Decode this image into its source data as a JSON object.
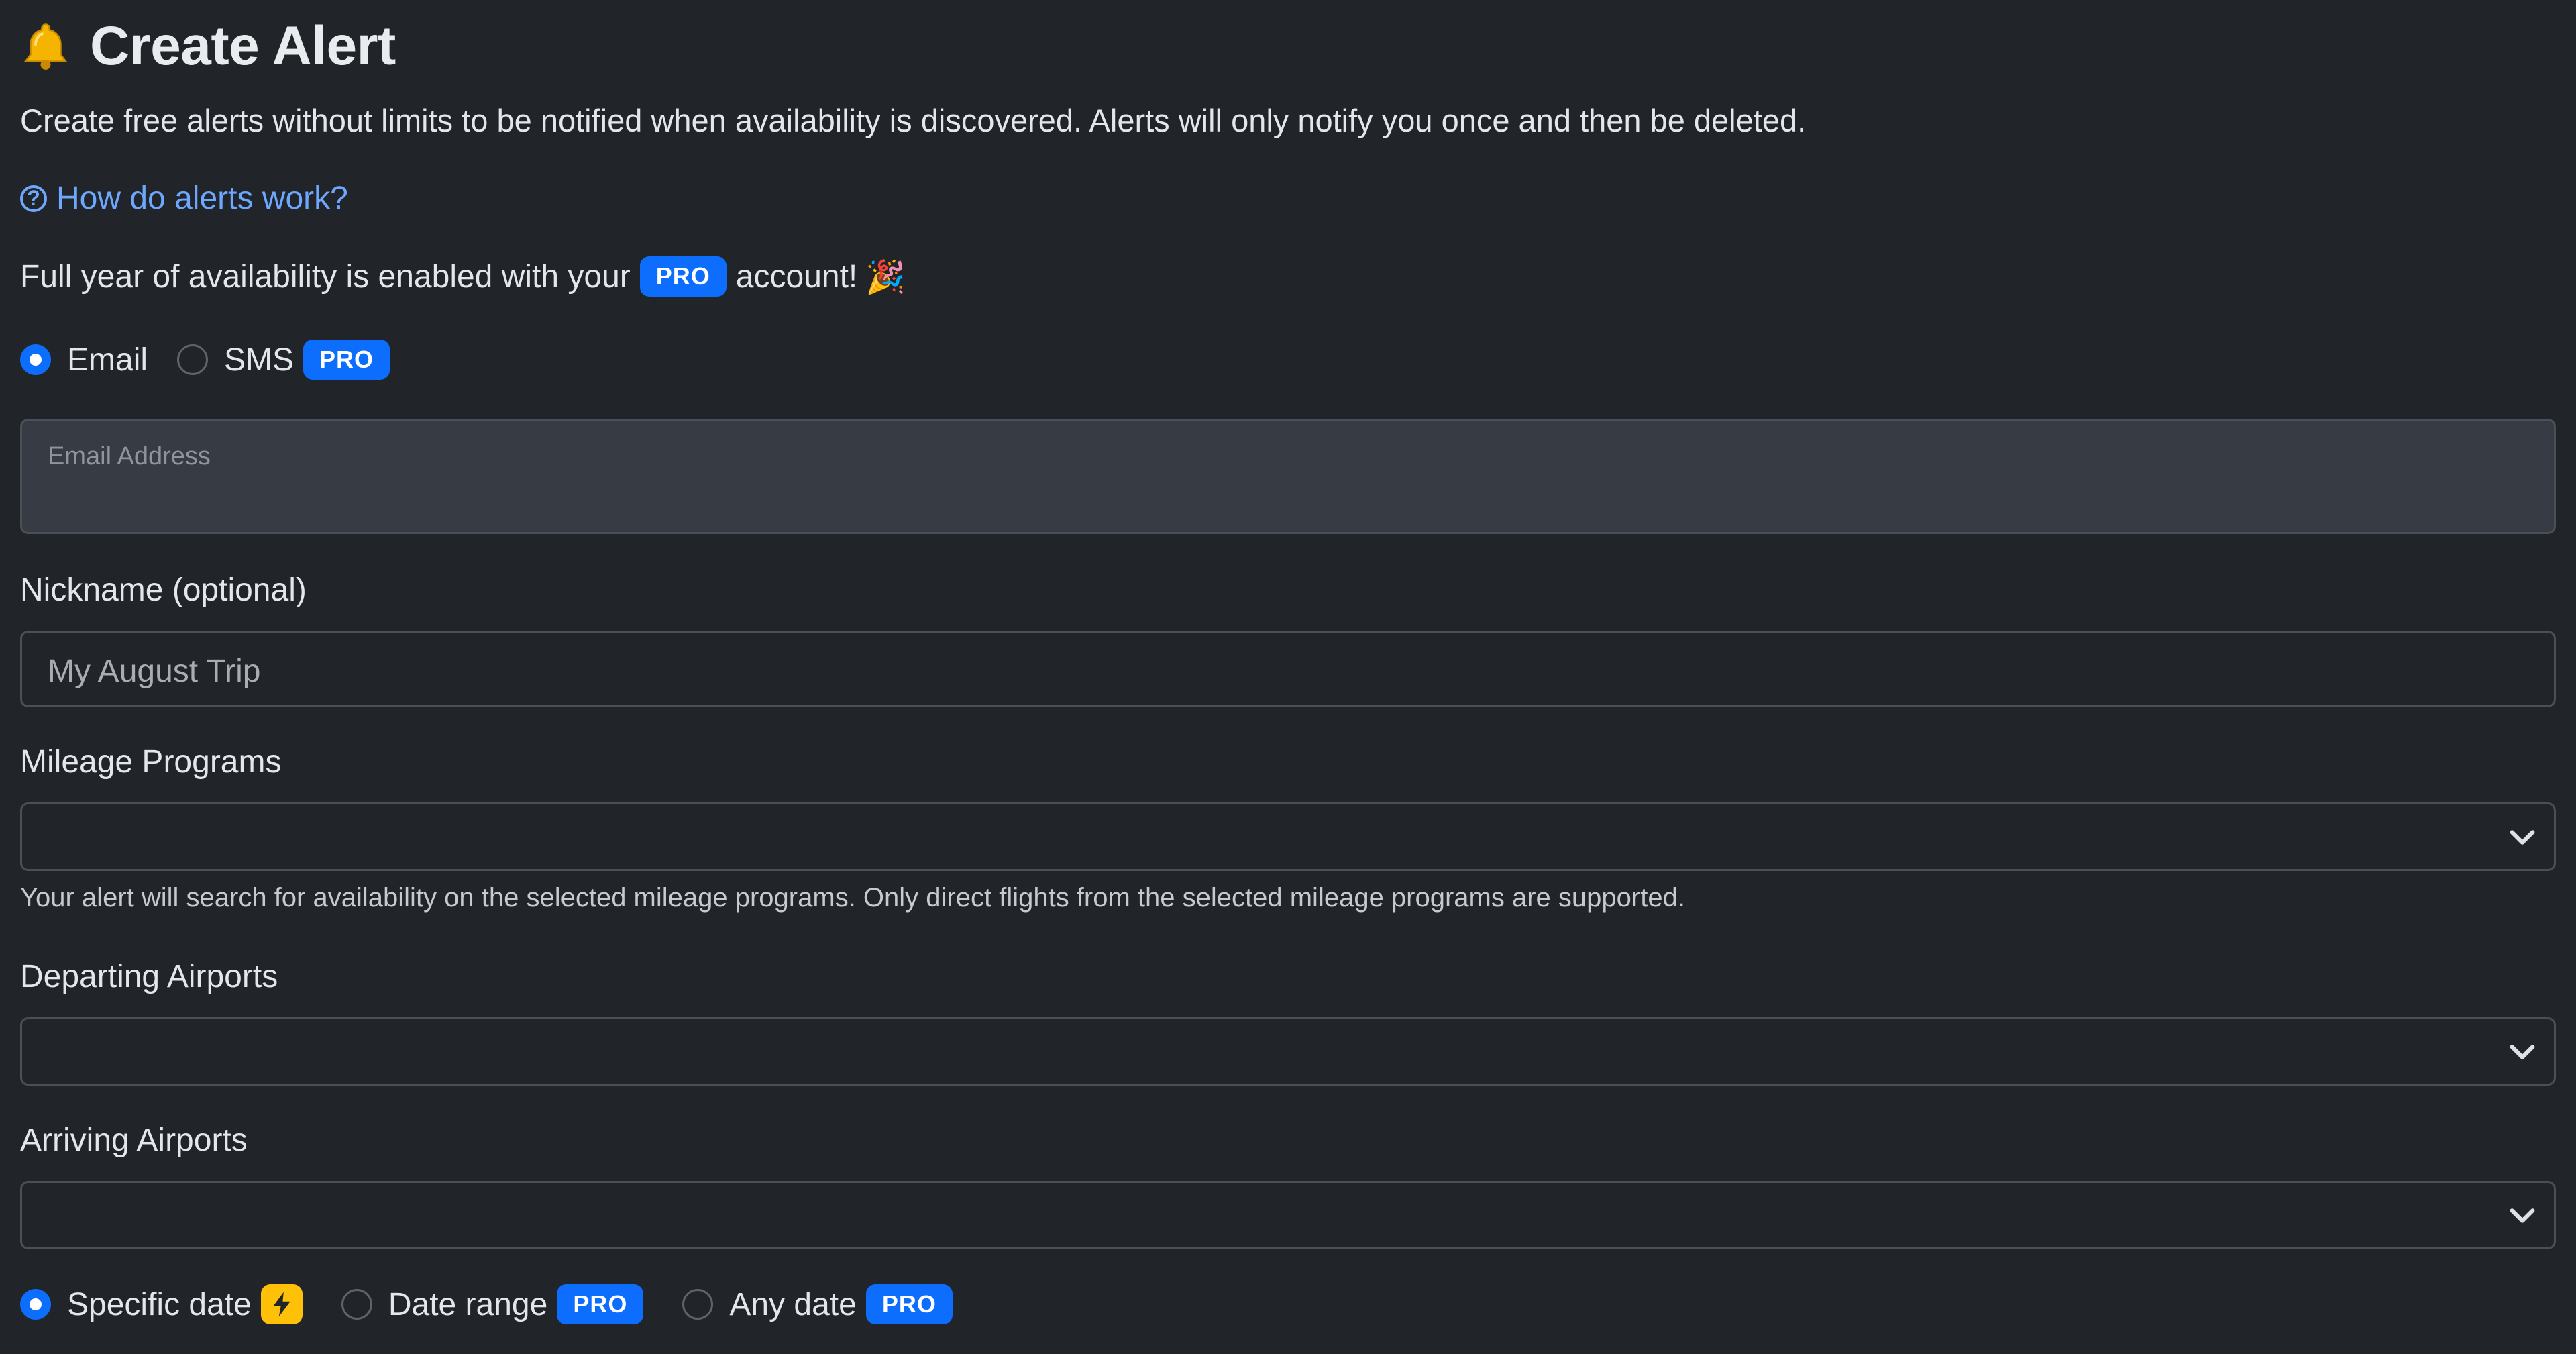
{
  "header": {
    "icon": "bell-icon",
    "title": "Create Alert"
  },
  "description": "Create free alerts without limits to be notified when availability is discovered. Alerts will only notify you once and then be deleted.",
  "help_link": {
    "icon": "question-circle-icon",
    "label": "How do alerts work?"
  },
  "pro_notice": {
    "before": "Full year of availability is enabled with your",
    "badge": "PRO",
    "after": "account!",
    "emoji": "🎉"
  },
  "notify_method": {
    "options": [
      {
        "label": "Email",
        "checked": true
      },
      {
        "label": "SMS",
        "checked": false,
        "badge": "PRO"
      }
    ]
  },
  "email": {
    "placeholder": "Email Address",
    "value": ""
  },
  "nickname": {
    "label": "Nickname (optional)",
    "placeholder": "My August Trip"
  },
  "mileage_programs": {
    "label": "Mileage Programs",
    "selected": "",
    "help": "Your alert will search for availability on the selected mileage programs. Only direct flights from the selected mileage programs are supported."
  },
  "departing_airports": {
    "label": "Departing Airports",
    "selected": ""
  },
  "arriving_airports": {
    "label": "Arriving Airports",
    "selected": ""
  },
  "date_mode": {
    "options": [
      {
        "label": "Specific date",
        "checked": true,
        "badge_icon": "lightning-bolt-icon"
      },
      {
        "label": "Date range",
        "checked": false,
        "badge": "PRO"
      },
      {
        "label": "Any date",
        "checked": false,
        "badge": "PRO"
      }
    ]
  },
  "colors": {
    "background": "#212529",
    "accent": "#0d6efd",
    "link": "#6ea8fe",
    "bolt_badge": "#ffc107",
    "input_fill": "#373b43",
    "border": "#495057"
  }
}
